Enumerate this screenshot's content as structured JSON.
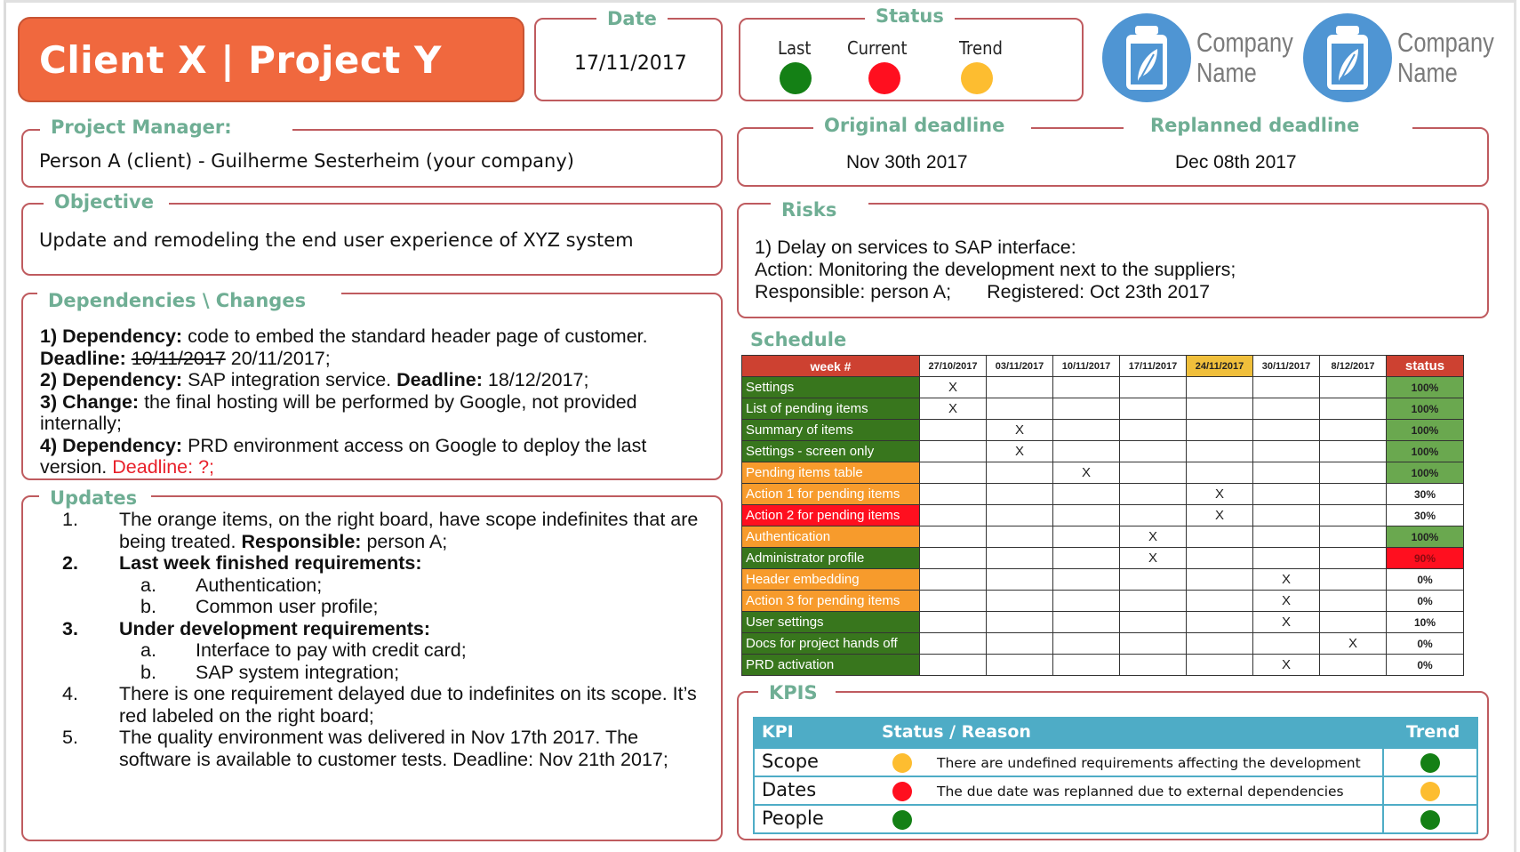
{
  "header": {
    "title": "Client X | Project Y",
    "date_label": "Date",
    "date_value": "17/11/2017",
    "status_label": "Status",
    "status_lamps": [
      {
        "label": "Last",
        "color": "#148015"
      },
      {
        "label": "Current",
        "color": "#ff0f1f"
      },
      {
        "label": "Trend",
        "color": "#fdbd30"
      }
    ],
    "logos": [
      {
        "line1": "Company",
        "line2": "Name",
        "icon": "bottle-leaf-icon"
      },
      {
        "line1": "Company",
        "line2": "Name",
        "icon": "bottle-leaf-icon"
      }
    ]
  },
  "project_manager": {
    "label": "Project Manager:",
    "value": "Person A (client) - Guilherme Sesterheim (your company)"
  },
  "deadlines": {
    "original_label": "Original deadline",
    "original_value": "Nov 30th 2017",
    "replanned_label": "Replanned deadline",
    "replanned_value": "Dec 08th 2017"
  },
  "objective": {
    "label": "Objective",
    "value": "Update and remodeling the end user experience of XYZ system"
  },
  "risks": {
    "label": "Risks",
    "lines": [
      "1) Delay on services to SAP interface:",
      "Action: Monitoring the development next to the suppliers;",
      "Responsible: person A;",
      "Registered: Oct 23th 2017"
    ]
  },
  "dependencies": {
    "label": "Dependencies \\ Changes",
    "items": [
      {
        "prefix": "1) Dependency:",
        "text": " code to embed the standard header page of customer.",
        "deadline_label": "Deadline:",
        "deadline_old": "10/11/2017",
        "deadline_new": " 20/11/2017;"
      },
      {
        "prefix": "2) Dependency:",
        "text": " SAP integration service. ",
        "deadline_label": "Deadline:",
        "deadline_new": " 18/12/2017;"
      },
      {
        "prefix": "3) Change:",
        "text": " the final hosting will be performed by Google, not provided internally;"
      },
      {
        "prefix": "4) Dependency:",
        "text": " PRD environment access on Google to deploy the last version. ",
        "deadline_alert": "Deadline: ?;"
      }
    ]
  },
  "updates": {
    "label": "Updates",
    "items": [
      {
        "num": "1.",
        "text": "The orange items, on the right board, have scope indefinites that are being treated. ",
        "bold_tail": "Responsible:",
        "tail": " person A;"
      },
      {
        "num": "2.",
        "bold_text": "Last week finished requirements:",
        "subs": [
          {
            "num": "a.",
            "text": "Authentication;"
          },
          {
            "num": "b.",
            "text": "Common user profile;"
          }
        ]
      },
      {
        "num": "3.",
        "bold_text": "Under development requirements:",
        "subs": [
          {
            "num": "a.",
            "text": "Interface to pay with credit card;"
          },
          {
            "num": "b.",
            "text": "SAP system integration;"
          }
        ]
      },
      {
        "num": "4.",
        "text": "There is one requirement delayed due to indefinites on its scope. It’s red labeled on the right board;"
      },
      {
        "num": "5.",
        "text": "The quality environment was delivered in Nov 17th 2017. The software is available to customer tests. Deadline: Nov 21th 2017;"
      }
    ]
  },
  "schedule": {
    "label": "Schedule",
    "week_header": "week #",
    "status_header": "status",
    "weeks": [
      "27/10/2017",
      "03/11/2017",
      "10/11/2017",
      "17/11/2017",
      "24/11/2017",
      "30/11/2017",
      "8/12/2017"
    ],
    "current_week_index": 4,
    "mark_symbol": "X",
    "colors": {
      "done": "#38761d",
      "scope_issue": "#f79b2c",
      "delayed": "#ff0f1f",
      "status_done": "#6aa84f",
      "status_late": "#ff0f1f",
      "status_open": "#ffffff"
    },
    "rows": [
      {
        "task": "Settings",
        "category": "done",
        "week": 0,
        "status": "100%",
        "status_state": "done"
      },
      {
        "task": "List of pending items",
        "category": "done",
        "week": 0,
        "status": "100%",
        "status_state": "done"
      },
      {
        "task": "Summary of items",
        "category": "done",
        "week": 1,
        "status": "100%",
        "status_state": "done"
      },
      {
        "task": "Settings - screen only",
        "category": "done",
        "week": 1,
        "status": "100%",
        "status_state": "done"
      },
      {
        "task": "Pending items table",
        "category": "scope_issue",
        "week": 2,
        "status": "100%",
        "status_state": "done"
      },
      {
        "task": "Action 1 for pending items",
        "category": "scope_issue",
        "week": 4,
        "status": "30%",
        "status_state": "open"
      },
      {
        "task": "Action 2 for pending items",
        "category": "delayed",
        "week": 4,
        "status": "30%",
        "status_state": "open"
      },
      {
        "task": "Authentication",
        "category": "scope_issue",
        "week": 3,
        "status": "100%",
        "status_state": "done"
      },
      {
        "task": "Administrator profile",
        "category": "done",
        "week": 3,
        "status": "90%",
        "status_state": "late"
      },
      {
        "task": "Header embedding",
        "category": "scope_issue",
        "week": 5,
        "status": "0%",
        "status_state": "open"
      },
      {
        "task": "Action 3 for pending items",
        "category": "scope_issue",
        "week": 5,
        "status": "0%",
        "status_state": "open"
      },
      {
        "task": "User settings",
        "category": "done",
        "week": 5,
        "status": "10%",
        "status_state": "open"
      },
      {
        "task": "Docs for project hands off",
        "category": "done",
        "week": 6,
        "status": "0%",
        "status_state": "open"
      },
      {
        "task": "PRD activation",
        "category": "done",
        "week": 5,
        "status": "0%",
        "status_state": "open"
      }
    ]
  },
  "kpis": {
    "label": "KPIS",
    "col_kpi": "KPI",
    "col_status": "Status / Reason",
    "col_trend": "Trend",
    "colors": {
      "green": "#148015",
      "red": "#ff0f1f",
      "yellow": "#fdbd30"
    },
    "rows": [
      {
        "name": "Scope",
        "status": "yellow",
        "reason": "There are undefined requirements affecting the development",
        "trend": "green"
      },
      {
        "name": "Dates",
        "status": "red",
        "reason": "The due date was replanned due to external dependencies",
        "trend": "yellow"
      },
      {
        "name": "People",
        "status": "green",
        "reason": "",
        "trend": "green"
      }
    ]
  }
}
